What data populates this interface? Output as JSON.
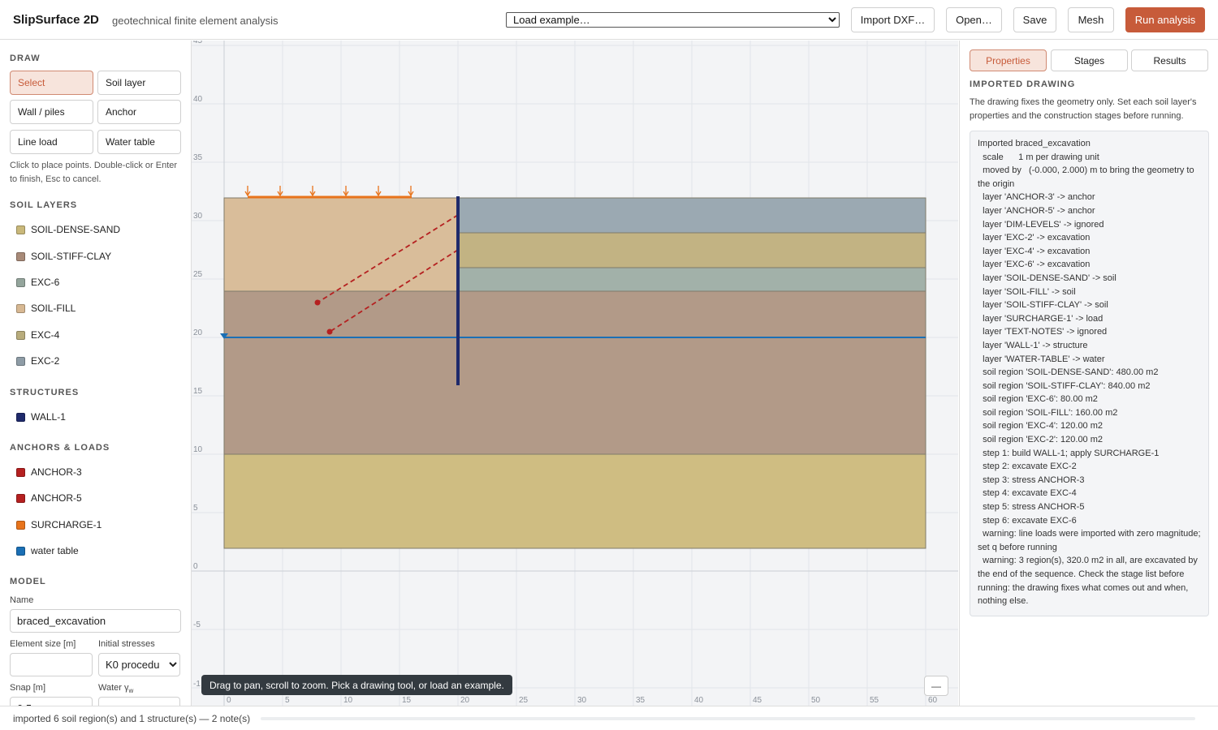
{
  "header": {
    "app_title": "SlipSurface 2D",
    "app_subtitle": "geotechnical finite element analysis",
    "example_select": "Load example…",
    "buttons": {
      "import": "Import DXF…",
      "open": "Open…",
      "save": "Save",
      "mesh": "Mesh",
      "run": "Run analysis"
    }
  },
  "colors": {
    "accent": "#c75b3a",
    "wall": "#1f2a6b",
    "anchor": "#b52020",
    "surcharge": "#e8741c",
    "water": "#1a6fb5"
  },
  "left_panel": {
    "draw_title": "DRAW",
    "tools": [
      {
        "label": "Select",
        "active": true
      },
      {
        "label": "Soil layer"
      },
      {
        "label": "Wall / piles"
      },
      {
        "label": "Anchor"
      },
      {
        "label": "Line load"
      },
      {
        "label": "Water table"
      }
    ],
    "draw_hint": "Click to place points. Double-click or Enter to finish, Esc to cancel.",
    "soil_layers_title": "SOIL LAYERS",
    "soil_layers": [
      {
        "name": "SOIL-DENSE-SAND",
        "color": "#c9b87a"
      },
      {
        "name": "SOIL-STIFF-CLAY",
        "color": "#a88a78"
      },
      {
        "name": "EXC-6",
        "color": "#94a59c"
      },
      {
        "name": "SOIL-FILL",
        "color": "#d7b893"
      },
      {
        "name": "EXC-4",
        "color": "#b8ac7c"
      },
      {
        "name": "EXC-2",
        "color": "#8e9ca6"
      }
    ],
    "structures_title": "STRUCTURES",
    "structures": [
      {
        "name": "WALL-1",
        "color": "#1f2a6b"
      }
    ],
    "anchors_title": "ANCHORS & LOADS",
    "anchors_loads": [
      {
        "name": "ANCHOR-3",
        "color": "#b52020"
      },
      {
        "name": "ANCHOR-5",
        "color": "#b52020"
      },
      {
        "name": "SURCHARGE-1",
        "color": "#e8741c"
      },
      {
        "name": "water table",
        "color": "#1a6fb5"
      }
    ],
    "model_title": "MODEL",
    "model": {
      "name_label": "Name",
      "name_value": "braced_excavation",
      "element_size_label": "Element size [m]",
      "element_size_value": "",
      "initial_stresses_label": "Initial stresses",
      "initial_stresses_value": "K0 procedu",
      "snap_label": "Snap [m]",
      "snap_value": "0.5",
      "water_gamma_label": "Water γ",
      "water_gamma_sub": "w",
      "water_gamma_value": ""
    }
  },
  "canvas": {
    "hint": "Drag to pan, scroll to zoom. Pick a drawing tool, or load an example.",
    "zoom_button": "—",
    "x_ticks": [
      0,
      5,
      10,
      15,
      20,
      25,
      30,
      35,
      40,
      45,
      50,
      55,
      60
    ],
    "y_ticks": [
      -1,
      -5,
      0,
      5,
      10,
      15,
      20,
      25,
      30,
      35,
      40,
      45
    ],
    "y_tick_labels": [
      "-1",
      "-5",
      "0",
      "5",
      "10",
      "15",
      "20",
      "25",
      "30",
      "35",
      "40",
      "45"
    ],
    "x_tick_labels": [
      "0",
      "5",
      "10",
      "15",
      "20",
      "25",
      "30",
      "35",
      "40",
      "45",
      "50",
      "55",
      "60"
    ],
    "water_level": 20,
    "wall": {
      "x": 20,
      "y_top": 32,
      "y_bottom": 16
    }
  },
  "right_panel": {
    "tabs": [
      {
        "label": "Properties",
        "active": true
      },
      {
        "label": "Stages"
      },
      {
        "label": "Results"
      }
    ],
    "heading": "IMPORTED DRAWING",
    "intro": "The drawing fixes the geometry only. Set each soil layer's properties and the construction stages before running.",
    "log": [
      "Imported braced_excavation",
      "  scale      1 m per drawing unit",
      "  moved by   (-0.000, 2.000) m to bring the geometry to the origin",
      "  layer 'ANCHOR-3' -> anchor",
      "  layer 'ANCHOR-5' -> anchor",
      "  layer 'DIM-LEVELS' -> ignored",
      "  layer 'EXC-2' -> excavation",
      "  layer 'EXC-4' -> excavation",
      "  layer 'EXC-6' -> excavation",
      "  layer 'SOIL-DENSE-SAND' -> soil",
      "  layer 'SOIL-FILL' -> soil",
      "  layer 'SOIL-STIFF-CLAY' -> soil",
      "  layer 'SURCHARGE-1' -> load",
      "  layer 'TEXT-NOTES' -> ignored",
      "  layer 'WALL-1' -> structure",
      "  layer 'WATER-TABLE' -> water",
      "  soil region 'SOIL-DENSE-SAND': 480.00 m2",
      "  soil region 'SOIL-STIFF-CLAY': 840.00 m2",
      "  soil region 'EXC-6': 80.00 m2",
      "  soil region 'SOIL-FILL': 160.00 m2",
      "  soil region 'EXC-4': 120.00 m2",
      "  soil region 'EXC-2': 120.00 m2",
      "  step 1: build WALL-1; apply SURCHARGE-1",
      "  step 2: excavate EXC-2",
      "  step 3: stress ANCHOR-3",
      "  step 4: excavate EXC-4",
      "  step 5: stress ANCHOR-5",
      "  step 6: excavate EXC-6",
      "  warning: line loads were imported with zero magnitude; set q before running",
      "  warning: 3 region(s), 320.0 m2 in all, are excavated by the end of the sequence. Check the stage list before running: the drawing fixes what comes out and when, nothing else."
    ]
  },
  "status": {
    "text": "imported 6 soil region(s) and 1 structure(s) — 2 note(s)",
    "progress": 0
  }
}
